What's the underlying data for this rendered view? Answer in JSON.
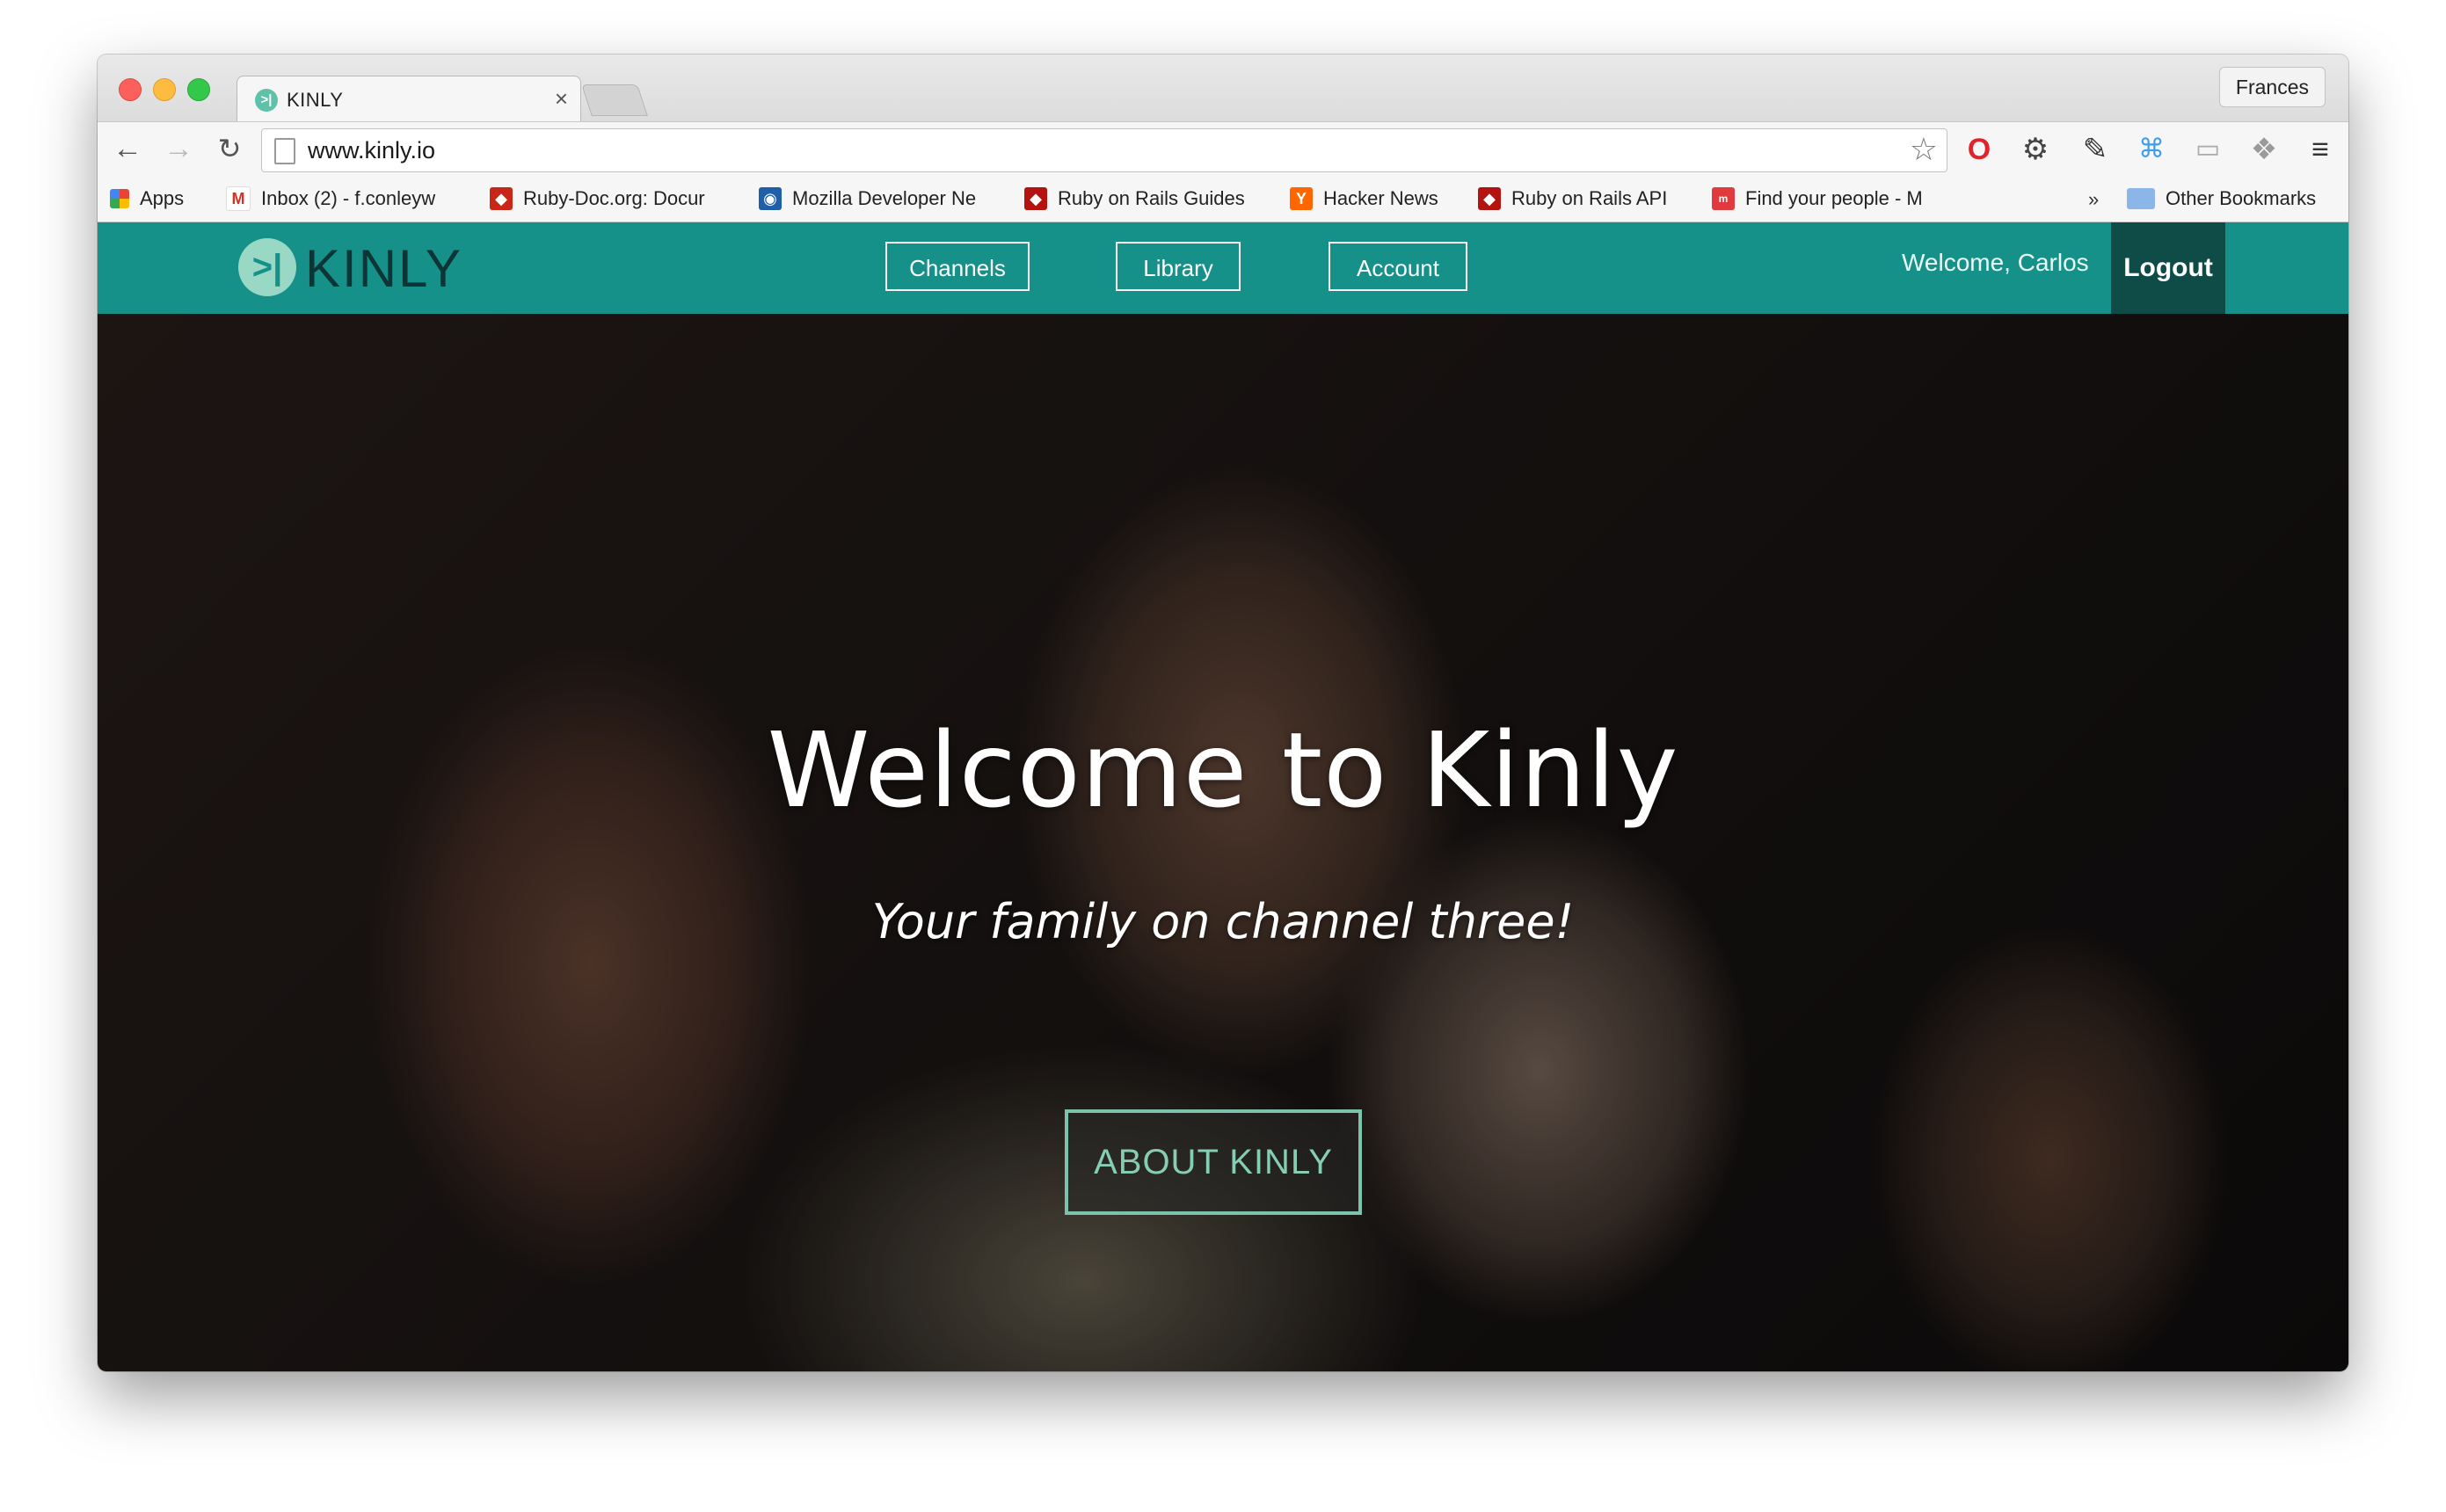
{
  "browser": {
    "tab": {
      "title": "KINLY",
      "favicon": ">|"
    },
    "profile": "Frances",
    "url": "www.kinly.io",
    "bookmarks": [
      {
        "label": "Apps",
        "icon": "apps-grid-icon"
      },
      {
        "label": "Inbox (2) - f.conleyw",
        "icon": "gmail-icon"
      },
      {
        "label": "Ruby-Doc.org: Docur",
        "icon": "ruby-icon"
      },
      {
        "label": "Mozilla Developer Ne",
        "icon": "mdn-icon"
      },
      {
        "label": "Ruby on Rails Guides",
        "icon": "rails-icon"
      },
      {
        "label": "Hacker News",
        "icon": "hn-icon"
      },
      {
        "label": "Ruby on Rails API",
        "icon": "rails-icon"
      },
      {
        "label": "Find your people - M",
        "icon": "meetup-icon"
      }
    ],
    "overflow": "»",
    "other_bookmarks": "Other Bookmarks"
  },
  "site": {
    "logo_text": "KINLY",
    "logo_mark": ">|",
    "nav": {
      "channels": "Channels",
      "library": "Library",
      "account": "Account"
    },
    "welcome": "Welcome, Carlos",
    "logout": "Logout"
  },
  "hero": {
    "title": "Welcome to Kinly",
    "subtitle": "Your family on channel three!",
    "cta": "ABOUT KINLY"
  },
  "colors": {
    "brand_teal": "#15918a",
    "logout_bg": "#0f4b47",
    "cta_border": "#7cc3ad"
  }
}
